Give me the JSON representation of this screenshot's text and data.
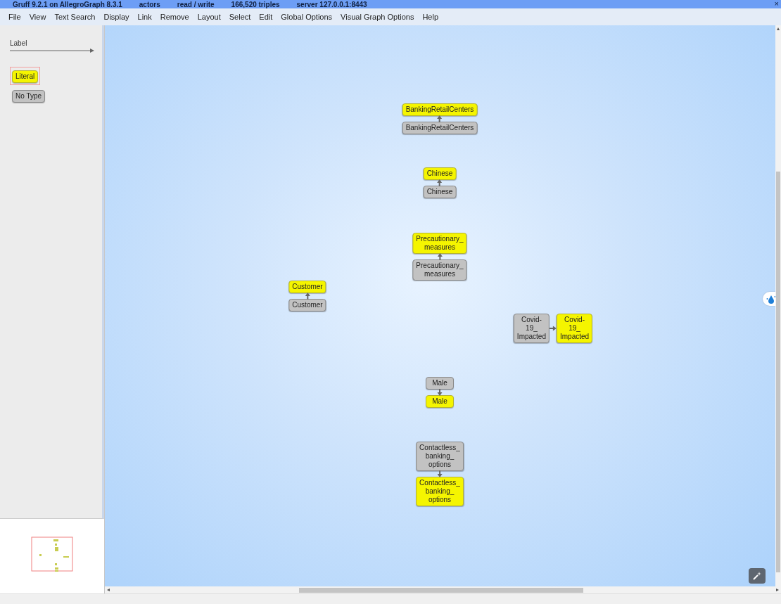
{
  "window": {
    "title_segments": [
      "Gruff 9.2.1 on AllegroGraph 8.3.1",
      "actors",
      "read / write",
      "166,520 triples",
      "server 127.0.0.1:8443"
    ],
    "close": "×"
  },
  "menu": [
    "File",
    "View",
    "Text Search",
    "Display",
    "Link",
    "Remove",
    "Layout",
    "Select",
    "Edit",
    "Global Options",
    "Visual Graph Options",
    "Help"
  ],
  "legend": {
    "predicate": "Label",
    "types": [
      {
        "label": "Literal",
        "kind": "literal",
        "selected": true
      },
      {
        "label": "No Type",
        "kind": "no_type",
        "selected": false
      }
    ]
  },
  "graph": {
    "links": [
      {
        "from": {
          "label": "BankingRetailCenters",
          "kind": "no_type"
        },
        "to": {
          "label": "BankingRetailCenters",
          "kind": "literal"
        }
      },
      {
        "from": {
          "label": "Chinese",
          "kind": "no_type"
        },
        "to": {
          "label": "Chinese",
          "kind": "literal"
        }
      },
      {
        "from": {
          "label": "Precautionary_ measures",
          "kind": "no_type"
        },
        "to": {
          "label": "Precautionary_ measures",
          "kind": "literal"
        }
      },
      {
        "from": {
          "label": "Customer",
          "kind": "no_type"
        },
        "to": {
          "label": "Customer",
          "kind": "literal"
        }
      },
      {
        "from": {
          "label": "Covid-19_ Impacted",
          "kind": "no_type"
        },
        "to": {
          "label": "Covid-19_ Impacted",
          "kind": "literal"
        }
      },
      {
        "from": {
          "label": "Male",
          "kind": "no_type"
        },
        "to": {
          "label": "Male",
          "kind": "literal"
        }
      },
      {
        "from": {
          "label": "Contactless_ banking_ options",
          "kind": "no_type"
        },
        "to": {
          "label": "Contactless_ banking_ options",
          "kind": "literal"
        }
      }
    ]
  }
}
